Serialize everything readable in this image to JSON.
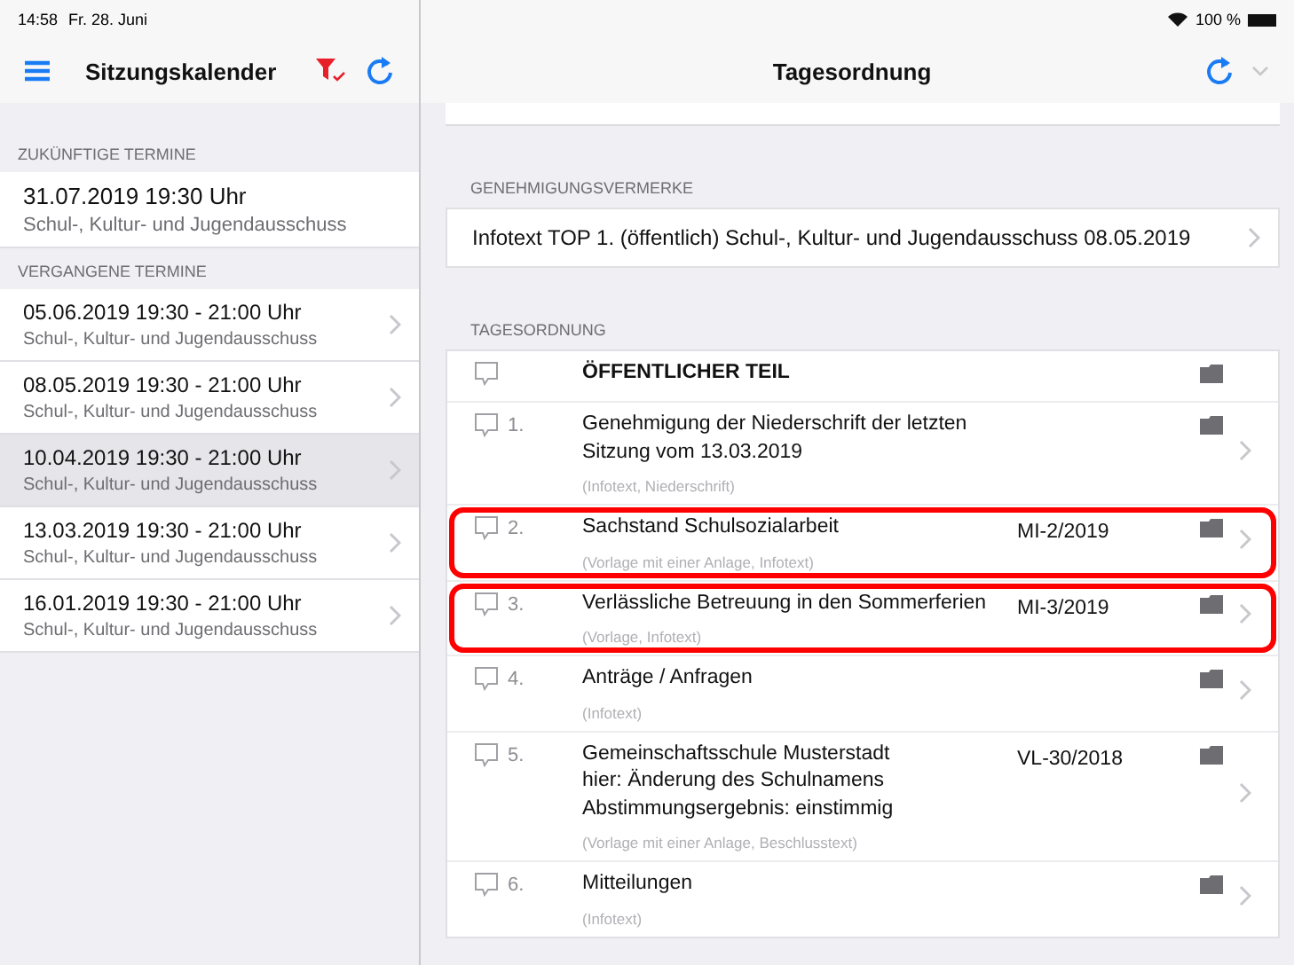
{
  "status_bar": {
    "time": "14:58",
    "date": "Fr. 28. Juni",
    "battery_text": "100 %"
  },
  "sidebar": {
    "title": "Sitzungskalender",
    "filter_active": true,
    "sections": [
      {
        "header": "ZUKÜNFTIGE TERMINE",
        "items": [
          {
            "date": "31.07.2019 19:30 Uhr",
            "committee": "Schul-, Kultur- und Jugendausschuss",
            "selected": false,
            "chevron": false
          }
        ]
      },
      {
        "header": "VERGANGENE TERMINE",
        "items": [
          {
            "date": "05.06.2019 19:30 -  21:00 Uhr",
            "committee": "Schul-, Kultur- und Jugendausschuss",
            "selected": false,
            "chevron": true
          },
          {
            "date": "08.05.2019 19:30 -  21:00 Uhr",
            "committee": "Schul-, Kultur- und Jugendausschuss",
            "selected": false,
            "chevron": true
          },
          {
            "date": "10.04.2019 19:30 -  21:00 Uhr",
            "committee": "Schul-, Kultur- und Jugendausschuss",
            "selected": true,
            "chevron": true
          },
          {
            "date": "13.03.2019 19:30 -  21:00 Uhr",
            "committee": "Schul-, Kultur- und Jugendausschuss",
            "selected": false,
            "chevron": true
          },
          {
            "date": "16.01.2019 19:30 -  21:00 Uhr",
            "committee": "Schul-, Kultur- und Jugendausschuss",
            "selected": false,
            "chevron": true
          }
        ]
      }
    ]
  },
  "detail": {
    "title": "Tagesordnung",
    "approvals": {
      "header": "GENEHMIGUNGSVERMERKE",
      "items": [
        "Infotext TOP 1. (öffentlich) Schul-, Kultur- und Jugendausschuss 08.05.2019"
      ]
    },
    "agenda": {
      "header": "TAGESORDNUNG",
      "items": [
        {
          "kind": "section",
          "title": "ÖFFENTLICHER TEIL",
          "highlighted": false
        },
        {
          "kind": "item",
          "number": "1.",
          "title": "Genehmigung der Niederschrift der letzten Sitzung vom 13.03.2019",
          "details": "(Infotext, Niederschrift)",
          "highlighted": false
        },
        {
          "kind": "item",
          "number": "2.",
          "title": "Sachstand Schulsozialarbeit",
          "reference": "MI-2/2019",
          "details": "(Vorlage mit einer Anlage, Infotext)",
          "highlighted": true
        },
        {
          "kind": "item",
          "number": "3.",
          "title": "Verlässliche Betreuung in den Sommerferien",
          "reference": "MI-3/2019",
          "details": "(Vorlage, Infotext)",
          "highlighted": true
        },
        {
          "kind": "item",
          "number": "4.",
          "title": "Anträge / Anfragen",
          "details": "(Infotext)",
          "highlighted": false
        },
        {
          "kind": "item",
          "number": "5.",
          "title": "Gemeinschaftsschule Musterstadt\nhier: Änderung des Schulnamens\nAbstimmungsergebnis: einstimmig",
          "reference": "VL-30/2018",
          "details": "(Vorlage mit einer Anlage, Beschlusstext)",
          "highlighted": false
        },
        {
          "kind": "item",
          "number": "6.",
          "title": "Mitteilungen",
          "details": "(Infotext)",
          "highlighted": false
        }
      ]
    }
  }
}
